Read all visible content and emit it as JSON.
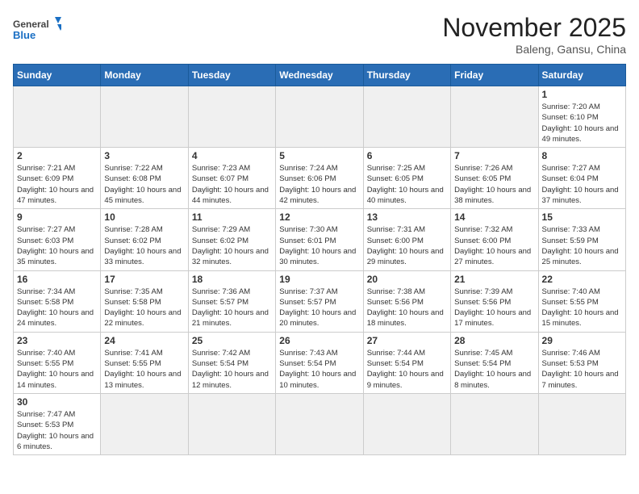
{
  "logo": {
    "text_general": "General",
    "text_blue": "Blue"
  },
  "header": {
    "month_title": "November 2025",
    "location": "Baleng, Gansu, China"
  },
  "weekdays": [
    "Sunday",
    "Monday",
    "Tuesday",
    "Wednesday",
    "Thursday",
    "Friday",
    "Saturday"
  ],
  "days": [
    {
      "num": "",
      "empty": true
    },
    {
      "num": "",
      "empty": true
    },
    {
      "num": "",
      "empty": true
    },
    {
      "num": "",
      "empty": true
    },
    {
      "num": "",
      "empty": true
    },
    {
      "num": "",
      "empty": true
    },
    {
      "num": "1",
      "sunrise": "7:20 AM",
      "sunset": "6:10 PM",
      "daylight": "10 hours and 49 minutes."
    },
    {
      "num": "2",
      "sunrise": "7:21 AM",
      "sunset": "6:09 PM",
      "daylight": "10 hours and 47 minutes."
    },
    {
      "num": "3",
      "sunrise": "7:22 AM",
      "sunset": "6:08 PM",
      "daylight": "10 hours and 45 minutes."
    },
    {
      "num": "4",
      "sunrise": "7:23 AM",
      "sunset": "6:07 PM",
      "daylight": "10 hours and 44 minutes."
    },
    {
      "num": "5",
      "sunrise": "7:24 AM",
      "sunset": "6:06 PM",
      "daylight": "10 hours and 42 minutes."
    },
    {
      "num": "6",
      "sunrise": "7:25 AM",
      "sunset": "6:05 PM",
      "daylight": "10 hours and 40 minutes."
    },
    {
      "num": "7",
      "sunrise": "7:26 AM",
      "sunset": "6:05 PM",
      "daylight": "10 hours and 38 minutes."
    },
    {
      "num": "8",
      "sunrise": "7:27 AM",
      "sunset": "6:04 PM",
      "daylight": "10 hours and 37 minutes."
    },
    {
      "num": "9",
      "sunrise": "7:27 AM",
      "sunset": "6:03 PM",
      "daylight": "10 hours and 35 minutes."
    },
    {
      "num": "10",
      "sunrise": "7:28 AM",
      "sunset": "6:02 PM",
      "daylight": "10 hours and 33 minutes."
    },
    {
      "num": "11",
      "sunrise": "7:29 AM",
      "sunset": "6:02 PM",
      "daylight": "10 hours and 32 minutes."
    },
    {
      "num": "12",
      "sunrise": "7:30 AM",
      "sunset": "6:01 PM",
      "daylight": "10 hours and 30 minutes."
    },
    {
      "num": "13",
      "sunrise": "7:31 AM",
      "sunset": "6:00 PM",
      "daylight": "10 hours and 29 minutes."
    },
    {
      "num": "14",
      "sunrise": "7:32 AM",
      "sunset": "6:00 PM",
      "daylight": "10 hours and 27 minutes."
    },
    {
      "num": "15",
      "sunrise": "7:33 AM",
      "sunset": "5:59 PM",
      "daylight": "10 hours and 25 minutes."
    },
    {
      "num": "16",
      "sunrise": "7:34 AM",
      "sunset": "5:58 PM",
      "daylight": "10 hours and 24 minutes."
    },
    {
      "num": "17",
      "sunrise": "7:35 AM",
      "sunset": "5:58 PM",
      "daylight": "10 hours and 22 minutes."
    },
    {
      "num": "18",
      "sunrise": "7:36 AM",
      "sunset": "5:57 PM",
      "daylight": "10 hours and 21 minutes."
    },
    {
      "num": "19",
      "sunrise": "7:37 AM",
      "sunset": "5:57 PM",
      "daylight": "10 hours and 20 minutes."
    },
    {
      "num": "20",
      "sunrise": "7:38 AM",
      "sunset": "5:56 PM",
      "daylight": "10 hours and 18 minutes."
    },
    {
      "num": "21",
      "sunrise": "7:39 AM",
      "sunset": "5:56 PM",
      "daylight": "10 hours and 17 minutes."
    },
    {
      "num": "22",
      "sunrise": "7:40 AM",
      "sunset": "5:55 PM",
      "daylight": "10 hours and 15 minutes."
    },
    {
      "num": "23",
      "sunrise": "7:40 AM",
      "sunset": "5:55 PM",
      "daylight": "10 hours and 14 minutes."
    },
    {
      "num": "24",
      "sunrise": "7:41 AM",
      "sunset": "5:55 PM",
      "daylight": "10 hours and 13 minutes."
    },
    {
      "num": "25",
      "sunrise": "7:42 AM",
      "sunset": "5:54 PM",
      "daylight": "10 hours and 12 minutes."
    },
    {
      "num": "26",
      "sunrise": "7:43 AM",
      "sunset": "5:54 PM",
      "daylight": "10 hours and 10 minutes."
    },
    {
      "num": "27",
      "sunrise": "7:44 AM",
      "sunset": "5:54 PM",
      "daylight": "10 hours and 9 minutes."
    },
    {
      "num": "28",
      "sunrise": "7:45 AM",
      "sunset": "5:54 PM",
      "daylight": "10 hours and 8 minutes."
    },
    {
      "num": "29",
      "sunrise": "7:46 AM",
      "sunset": "5:53 PM",
      "daylight": "10 hours and 7 minutes."
    },
    {
      "num": "30",
      "sunrise": "7:47 AM",
      "sunset": "5:53 PM",
      "daylight": "10 hours and 6 minutes."
    },
    {
      "num": "",
      "empty": true
    },
    {
      "num": "",
      "empty": true
    },
    {
      "num": "",
      "empty": true
    },
    {
      "num": "",
      "empty": true
    },
    {
      "num": "",
      "empty": true
    },
    {
      "num": "",
      "empty": true
    }
  ],
  "labels": {
    "sunrise": "Sunrise:",
    "sunset": "Sunset:",
    "daylight": "Daylight:"
  }
}
